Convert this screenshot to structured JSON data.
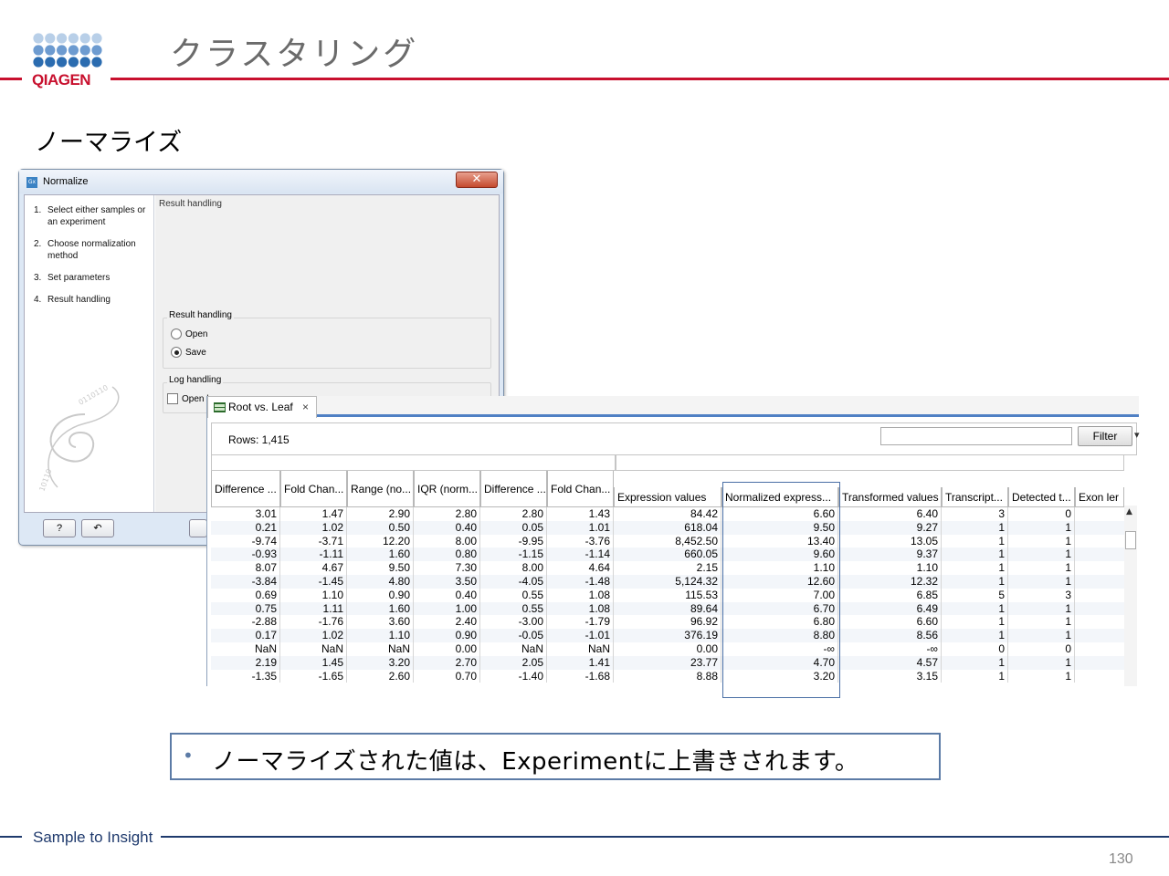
{
  "slide": {
    "title": "クラスタリング",
    "subtitle": "ノーマライズ",
    "brand": "QIAGEN",
    "footer": "Sample to Insight",
    "page_number": "130",
    "note": "ノーマライズされた値は、Experimentに上書きされます。",
    "note_bullet": "•",
    "brand_colors": {
      "red": "#c8102e",
      "navy": "#1f3a6d",
      "blue": "#2b6cb0"
    }
  },
  "dialog": {
    "title": "Normalize",
    "app_icon": "Gx",
    "close_glyph": "✕",
    "steps": [
      {
        "num": "1.",
        "label": "Select either samples or an experiment"
      },
      {
        "num": "2.",
        "label": "Choose normalization method"
      },
      {
        "num": "3.",
        "label": "Set parameters"
      },
      {
        "num": "4.",
        "label": "Result handling"
      }
    ],
    "pane_header": "Result handling",
    "result_group": {
      "title": "Result handling",
      "options": [
        {
          "label": "Open",
          "selected": false
        },
        {
          "label": "Save",
          "selected": true
        }
      ]
    },
    "log_group": {
      "title": "Log handling",
      "option": {
        "label": "Open log",
        "checked": false
      }
    },
    "help_button": "?",
    "reset_button": "↶"
  },
  "table_window": {
    "tab_label": "Root vs. Leaf",
    "tab_close": "×",
    "rows_label": "Rows: 1,415",
    "filter_placeholder": "",
    "filter_button": "Filter",
    "columns": [
      "Difference ...",
      "Fold Chan...",
      "Range (no...",
      "IQR (norm...",
      "Difference ...",
      "Fold Chan...",
      "Expression values",
      "Normalized express...",
      "Transformed values",
      "Transcript...",
      "Detected t...",
      "Exon ler"
    ],
    "rows": [
      [
        "3.01",
        "1.47",
        "2.90",
        "2.80",
        "2.80",
        "1.43",
        "84.42",
        "6.60",
        "6.40",
        "3",
        "0"
      ],
      [
        "0.21",
        "1.02",
        "0.50",
        "0.40",
        "0.05",
        "1.01",
        "618.04",
        "9.50",
        "9.27",
        "1",
        "1"
      ],
      [
        "-9.74",
        "-3.71",
        "12.20",
        "8.00",
        "-9.95",
        "-3.76",
        "8,452.50",
        "13.40",
        "13.05",
        "1",
        "1"
      ],
      [
        "-0.93",
        "-1.11",
        "1.60",
        "0.80",
        "-1.15",
        "-1.14",
        "660.05",
        "9.60",
        "9.37",
        "1",
        "1"
      ],
      [
        "8.07",
        "4.67",
        "9.50",
        "7.30",
        "8.00",
        "4.64",
        "2.15",
        "1.10",
        "1.10",
        "1",
        "1"
      ],
      [
        "-3.84",
        "-1.45",
        "4.80",
        "3.50",
        "-4.05",
        "-1.48",
        "5,124.32",
        "12.60",
        "12.32",
        "1",
        "1"
      ],
      [
        "0.69",
        "1.10",
        "0.90",
        "0.40",
        "0.55",
        "1.08",
        "115.53",
        "7.00",
        "6.85",
        "5",
        "3"
      ],
      [
        "0.75",
        "1.11",
        "1.60",
        "1.00",
        "0.55",
        "1.08",
        "89.64",
        "6.70",
        "6.49",
        "1",
        "1"
      ],
      [
        "-2.88",
        "-1.76",
        "3.60",
        "2.40",
        "-3.00",
        "-1.79",
        "96.92",
        "6.80",
        "6.60",
        "1",
        "1"
      ],
      [
        "0.17",
        "1.02",
        "1.10",
        "0.90",
        "-0.05",
        "-1.01",
        "376.19",
        "8.80",
        "8.56",
        "1",
        "1"
      ],
      [
        "NaN",
        "NaN",
        "NaN",
        "0.00",
        "NaN",
        "NaN",
        "0.00",
        "-∞",
        "-∞",
        "0",
        "0"
      ],
      [
        "2.19",
        "1.45",
        "3.20",
        "2.70",
        "2.05",
        "1.41",
        "23.77",
        "4.70",
        "4.57",
        "1",
        "1"
      ],
      [
        "-1.35",
        "-1.65",
        "2.60",
        "0.70",
        "-1.40",
        "-1.68",
        "8.88",
        "3.20",
        "3.15",
        "1",
        "1"
      ]
    ]
  }
}
